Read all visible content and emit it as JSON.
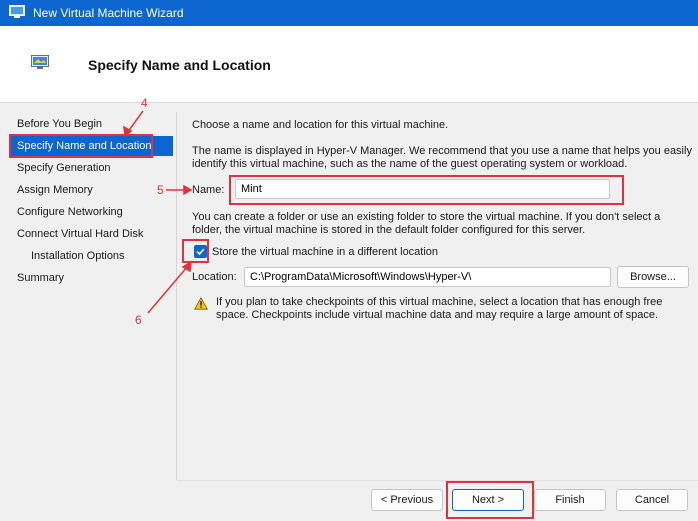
{
  "window": {
    "title": "New Virtual Machine Wizard"
  },
  "header": {
    "title": "Specify Name and Location"
  },
  "nav": {
    "items": [
      {
        "label": "Before You Begin"
      },
      {
        "label": "Specify Name and Location",
        "selected": true
      },
      {
        "label": "Specify Generation"
      },
      {
        "label": "Assign Memory"
      },
      {
        "label": "Configure Networking"
      },
      {
        "label": "Connect Virtual Hard Disk"
      },
      {
        "label": "Installation Options"
      },
      {
        "label": "Summary"
      }
    ]
  },
  "content": {
    "intro": "Choose a name and location for this virtual machine.",
    "name_help_1": "The name is displayed in Hyper-V Manager. We recommend that you use a name that helps you easily",
    "name_help_2": "identify this virtual machine, such as the name of the guest operating system or workload.",
    "name_label": "Name:",
    "name_value": "Mint",
    "folder_help_1": "You can create a folder or use an existing folder to store the virtual machine. If you don't select a",
    "folder_help_2": "folder, the virtual machine is stored in the default folder configured for this server.",
    "store_checkbox_label": "Store the virtual machine in a different location",
    "store_checked": true,
    "location_label": "Location:",
    "location_value": "C:\\ProgramData\\Microsoft\\Windows\\Hyper-V\\",
    "browse_label": "Browse...",
    "warning_1": "If you plan to take checkpoints of this virtual machine, select a location that has enough free",
    "warning_2": "space. Checkpoints include virtual machine data and may require a large amount of space."
  },
  "buttons": {
    "previous": "< Previous",
    "next": "Next >",
    "finish": "Finish",
    "cancel": "Cancel"
  },
  "annotations": {
    "n4": "4",
    "n5": "5",
    "n6": "6"
  },
  "colors": {
    "accent": "#0b66d2",
    "annotation": "#e0323a",
    "titlebar": "#0d66d0"
  }
}
